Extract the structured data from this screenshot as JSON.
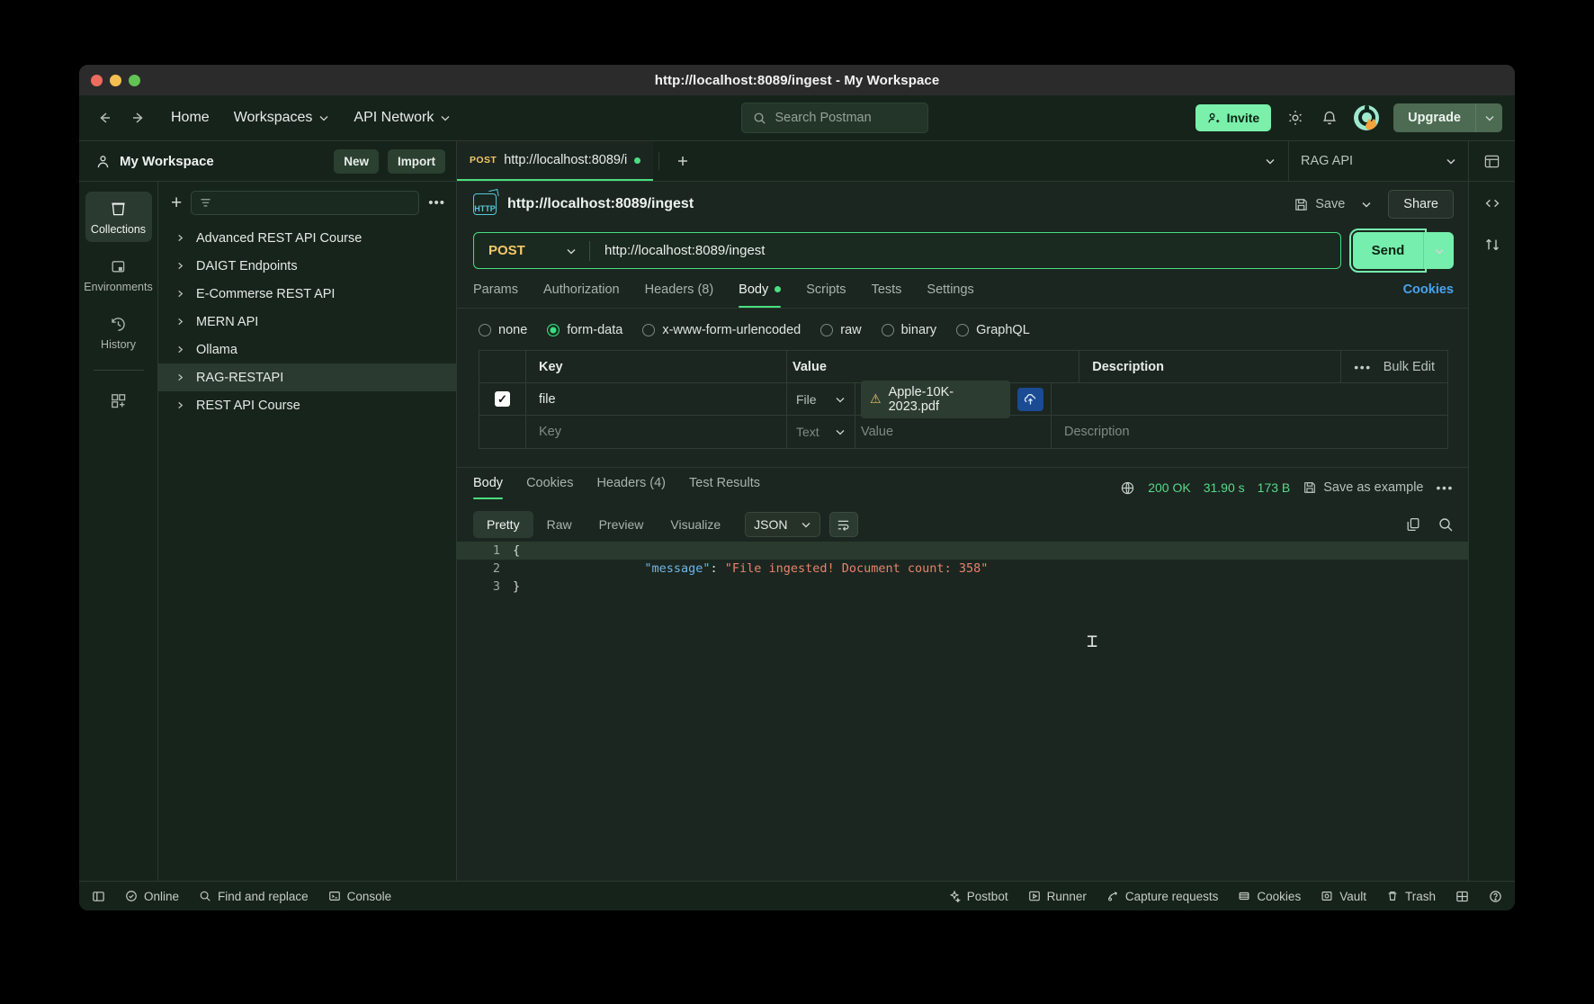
{
  "window": {
    "title": "http://localhost:8089/ingest - My Workspace"
  },
  "topnav": {
    "back_icon": "arrow-left-icon",
    "forward_icon": "arrow-right-icon",
    "links": [
      {
        "label": "Home",
        "caret": false
      },
      {
        "label": "Workspaces",
        "caret": true
      },
      {
        "label": "API Network",
        "caret": true
      }
    ],
    "search": {
      "placeholder": "Search Postman",
      "icon": "search-icon"
    },
    "invite_label": "Invite",
    "settings_icon": "gear-icon",
    "notifications_icon": "bell-icon",
    "avatar": "user-avatar",
    "upgrade_label": "Upgrade",
    "accent_green": "#7af0ab"
  },
  "workspace": {
    "name": "My Workspace",
    "new_label": "New",
    "import_label": "Import",
    "environment": "RAG API",
    "tab": {
      "method": "POST",
      "title": "http://localhost:8089/i",
      "unsaved": true
    },
    "add_tab_icon": "plus-icon",
    "tabs_caret_icon": "chevron-down-icon",
    "layout_icon": "layout-icon"
  },
  "rail": {
    "items": [
      {
        "label": "Collections",
        "icon": "collections-icon",
        "active": true
      },
      {
        "label": "Environments",
        "icon": "environments-icon",
        "active": false
      },
      {
        "label": "History",
        "icon": "history-icon",
        "active": false
      }
    ],
    "add_more_icon": "add-modules-icon"
  },
  "sidebar": {
    "new_icon": "plus-icon",
    "filter_placeholder": "",
    "filter_icon": "filter-icon",
    "more_icon": "more-horizontal-icon",
    "collections": [
      {
        "name": "Advanced REST API Course",
        "selected": false
      },
      {
        "name": "DAIGT Endpoints",
        "selected": false
      },
      {
        "name": "E-Commerse REST API",
        "selected": false
      },
      {
        "name": "MERN API",
        "selected": false
      },
      {
        "name": "Ollama",
        "selected": false
      },
      {
        "name": "RAG-RESTAPI",
        "selected": true
      },
      {
        "name": "REST API Course",
        "selected": false
      }
    ]
  },
  "request": {
    "protocol_badge": "HTTP",
    "title": "http://localhost:8089/ingest",
    "save_label": "Save",
    "save_icon": "save-icon",
    "share_label": "Share",
    "method": "POST",
    "url": "http://localhost:8089/ingest",
    "send_label": "Send",
    "tabs": [
      {
        "label": "Params",
        "active": false,
        "dot": false
      },
      {
        "label": "Authorization",
        "active": false,
        "dot": false
      },
      {
        "label": "Headers (8)",
        "active": false,
        "dot": false
      },
      {
        "label": "Body",
        "active": true,
        "dot": true
      },
      {
        "label": "Scripts",
        "active": false,
        "dot": false
      },
      {
        "label": "Tests",
        "active": false,
        "dot": false
      },
      {
        "label": "Settings",
        "active": false,
        "dot": false
      }
    ],
    "cookies_link": "Cookies",
    "body_types": [
      {
        "label": "none",
        "selected": false
      },
      {
        "label": "form-data",
        "selected": true
      },
      {
        "label": "x-www-form-urlencoded",
        "selected": false
      },
      {
        "label": "raw",
        "selected": false
      },
      {
        "label": "binary",
        "selected": false
      },
      {
        "label": "GraphQL",
        "selected": false
      }
    ],
    "table": {
      "headers": {
        "key": "Key",
        "value": "Value",
        "description": "Description"
      },
      "bulk_edit": "Bulk Edit",
      "more_icon": "more-horizontal-icon",
      "rows": [
        {
          "checked": true,
          "key": "file",
          "type": "File",
          "value": "Apple-10K-2023.pdf",
          "warning": true,
          "upload_icon": "upload-cloud-icon",
          "description": ""
        }
      ],
      "empty_row": {
        "key_placeholder": "Key",
        "type": "Text",
        "value_placeholder": "Value",
        "description_placeholder": "Description"
      }
    }
  },
  "response": {
    "tabs": [
      {
        "label": "Body",
        "active": true
      },
      {
        "label": "Cookies",
        "active": false
      },
      {
        "label": "Headers (4)",
        "active": false
      },
      {
        "label": "Test Results",
        "active": false
      }
    ],
    "globe_icon": "globe-icon",
    "status": "200 OK",
    "time": "31.90 s",
    "size": "173 B",
    "save_example": "Save as example",
    "more_icon": "more-horizontal-icon",
    "viewer_tabs": [
      {
        "label": "Pretty",
        "active": true
      },
      {
        "label": "Raw",
        "active": false
      },
      {
        "label": "Preview",
        "active": false
      },
      {
        "label": "Visualize",
        "active": false
      }
    ],
    "language": "JSON",
    "wrap_icon": "word-wrap-icon",
    "copy_icon": "copy-icon",
    "search_icon": "search-icon",
    "code_lines": [
      {
        "n": "1",
        "segments": [
          {
            "text": "{",
            "type": "punct"
          }
        ],
        "highlight": true
      },
      {
        "n": "2",
        "segments": [
          {
            "text": "    ",
            "type": "plain"
          },
          {
            "text": "\"message\"",
            "type": "key"
          },
          {
            "text": ": ",
            "type": "punct"
          },
          {
            "text": "\"File ingested! Document count: 358\"",
            "type": "str"
          }
        ],
        "highlight": false
      },
      {
        "n": "3",
        "segments": [
          {
            "text": "}",
            "type": "punct"
          }
        ],
        "highlight": false
      }
    ]
  },
  "right_rail": {
    "items": [
      {
        "icon": "code-icon"
      },
      {
        "icon": "sync-icon"
      }
    ]
  },
  "statusbar": {
    "sidebar_toggle_icon": "panel-icon",
    "left_items": [
      {
        "label": "Online",
        "icon": "check-circle-icon"
      },
      {
        "label": "Find and replace",
        "icon": "search-icon"
      },
      {
        "label": "Console",
        "icon": "terminal-icon"
      }
    ],
    "right_items": [
      {
        "label": "Postbot",
        "icon": "postbot-icon"
      },
      {
        "label": "Runner",
        "icon": "play-icon"
      },
      {
        "label": "Capture requests",
        "icon": "capture-icon"
      },
      {
        "label": "Cookies",
        "icon": "cookie-icon"
      },
      {
        "label": "Vault",
        "icon": "vault-icon"
      },
      {
        "label": "Trash",
        "icon": "trash-icon"
      }
    ],
    "layout_icon": "layout-grid-icon",
    "help_icon": "help-circle-icon"
  }
}
